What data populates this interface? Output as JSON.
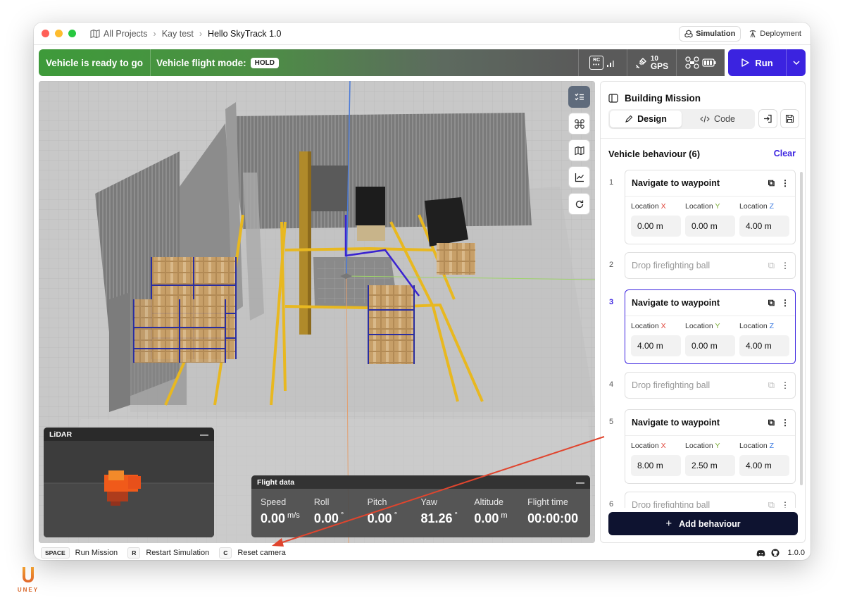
{
  "breadcrumb": {
    "items": [
      "All Projects",
      "Kay test"
    ],
    "current": "Hello SkyTrack 1.0"
  },
  "mode_tabs": {
    "simulation": "Simulation",
    "deployment": "Deployment"
  },
  "status": {
    "ready": "Vehicle is ready to go",
    "mode_label": "Vehicle flight mode:",
    "mode_value": "HOLD"
  },
  "indicators": {
    "rc": "RC",
    "gps_count": "10",
    "gps_label": "GPS"
  },
  "run": {
    "label": "Run"
  },
  "lidar": {
    "title": "LiDAR"
  },
  "flight": {
    "title": "Flight data",
    "fields": [
      {
        "label": "Speed",
        "value": "0.00",
        "unit": "m/s"
      },
      {
        "label": "Roll",
        "value": "0.00",
        "unit": "°"
      },
      {
        "label": "Pitch",
        "value": "0.00",
        "unit": "°"
      },
      {
        "label": "Yaw",
        "value": "81.26",
        "unit": "°"
      },
      {
        "label": "Altitude",
        "value": "0.00",
        "unit": "m"
      },
      {
        "label": "Flight time",
        "value": "00:00:00",
        "unit": ""
      }
    ]
  },
  "sidebar": {
    "title": "Building Mission",
    "tabs": {
      "design": "Design",
      "code": "Code"
    },
    "section": "Vehicle behaviour (6)",
    "clear": "Clear",
    "loc_labels": {
      "x": "Location ",
      "x_axis": "X",
      "y": "Location ",
      "y_axis": "Y",
      "z": "Location ",
      "z_axis": "Z"
    },
    "items": [
      {
        "num": "1",
        "title": "Navigate to waypoint",
        "x": "0.00 m",
        "y": "0.00 m",
        "z": "4.00 m"
      },
      {
        "num": "2",
        "title": "Drop firefighting ball"
      },
      {
        "num": "3",
        "title": "Navigate to waypoint",
        "x": "4.00 m",
        "y": "0.00 m",
        "z": "4.00 m"
      },
      {
        "num": "4",
        "title": "Drop firefighting ball"
      },
      {
        "num": "5",
        "title": "Navigate to waypoint",
        "x": "8.00 m",
        "y": "2.50 m",
        "z": "4.00 m"
      },
      {
        "num": "6",
        "title": "Drop firefighting ball"
      }
    ],
    "add_button": "Add behaviour"
  },
  "bottom": {
    "keys": [
      {
        "key": "SPACE",
        "label": "Run Mission"
      },
      {
        "key": "R",
        "label": "Restart Simulation"
      },
      {
        "key": "C",
        "label": "Reset camera"
      }
    ],
    "version": "1.0.0"
  },
  "brand": {
    "logo_text": "UNEY"
  },
  "colors": {
    "accent": "#3b23e0",
    "ready_green": "#3e9a3a",
    "annotation_arrow": "#e0452e"
  }
}
